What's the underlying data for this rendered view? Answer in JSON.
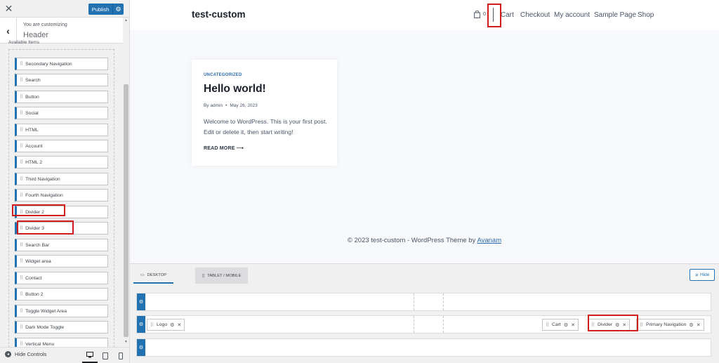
{
  "sidebar": {
    "close_icon": "close-icon",
    "publish_label": "Publish",
    "customizing_label": "You are customizing",
    "customizing_title": "Header",
    "available_label": "Available Items",
    "items": [
      "Secondary Navigation",
      "Search",
      "Button",
      "Social",
      "HTML",
      "Account",
      "HTML 2",
      "Third Navigation",
      "Fourth Navigation",
      "Divider 2",
      "Divider 3",
      "Search Bar",
      "Widget area",
      "Contact",
      "Button 2",
      "Toggle Widget Area",
      "Dark Mode Toggle",
      "Vertical Menu"
    ],
    "footer_label": "Hide Controls"
  },
  "preview": {
    "site_title": "test-custom",
    "cart_count": "0",
    "nav": [
      "Cart",
      "Checkout",
      "My account",
      "Sample Page",
      "Shop"
    ],
    "post": {
      "category": "UNCATEGORIZED",
      "title": "Hello world!",
      "author": "By admin",
      "date": "May 26, 2023",
      "excerpt": "Welcome to WordPress. This is your first post. Edit or delete it, then start writing!",
      "read_more": "READ MORE ⟶"
    },
    "footer_text": "© 2023 test-custom - WordPress Theme by",
    "footer_link": "Avanam"
  },
  "builder": {
    "tab_desktop": "DESKTOP",
    "tab_tablet": "TABLET / MOBILE",
    "hide_label": "Hide",
    "chips": {
      "logo": "Logo",
      "cart": "Cart",
      "divider": "Divider",
      "primary_nav": "Primary Navigation"
    }
  },
  "colors": {
    "accent": "#2271b1",
    "highlight": "#d11c1c",
    "link": "#2b6cb0"
  }
}
